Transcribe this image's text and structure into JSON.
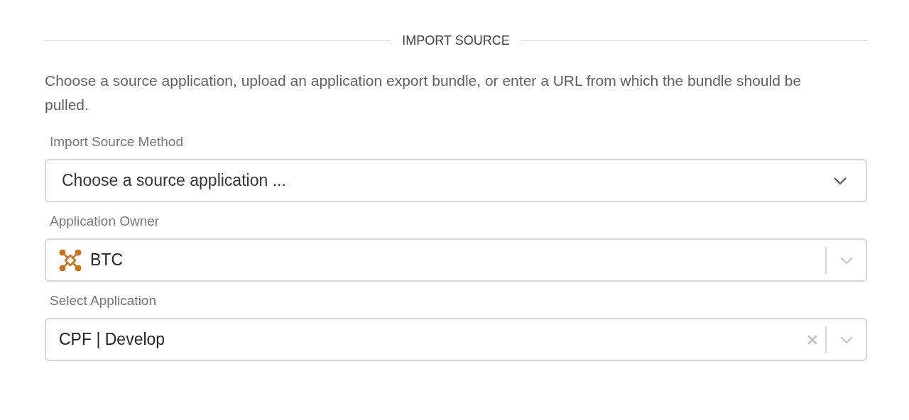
{
  "section_title": "IMPORT SOURCE",
  "description": "Choose a source application, upload an application export bundle, or enter a URL from which the bundle should be pulled.",
  "fields": [
    {
      "kind": "native",
      "label": "Import Source Method",
      "value": "Choose a source application ..."
    },
    {
      "kind": "combo",
      "label": "Application Owner",
      "value": "BTC",
      "has_icon": true,
      "clearable": false
    },
    {
      "kind": "combo",
      "label": "Select Application",
      "value": "CPF | Develop",
      "has_icon": false,
      "clearable": true
    }
  ]
}
